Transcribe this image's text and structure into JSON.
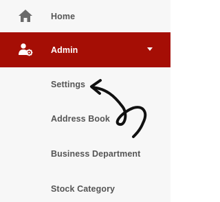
{
  "nav": {
    "home": {
      "label": "Home",
      "icon": "home-icon"
    },
    "admin": {
      "label": "Admin",
      "icon": "users-gear-icon",
      "expanded": true
    },
    "submenu": [
      {
        "label": "Settings"
      },
      {
        "label": "Address Book"
      },
      {
        "label": "Business Department"
      },
      {
        "label": "Stock Category"
      }
    ]
  },
  "colors": {
    "active_background": "#a50e05",
    "sidebar_background": "#f7f7f7",
    "text": "#555555",
    "icon": "#6a6a6a",
    "annotation": "#111111"
  }
}
